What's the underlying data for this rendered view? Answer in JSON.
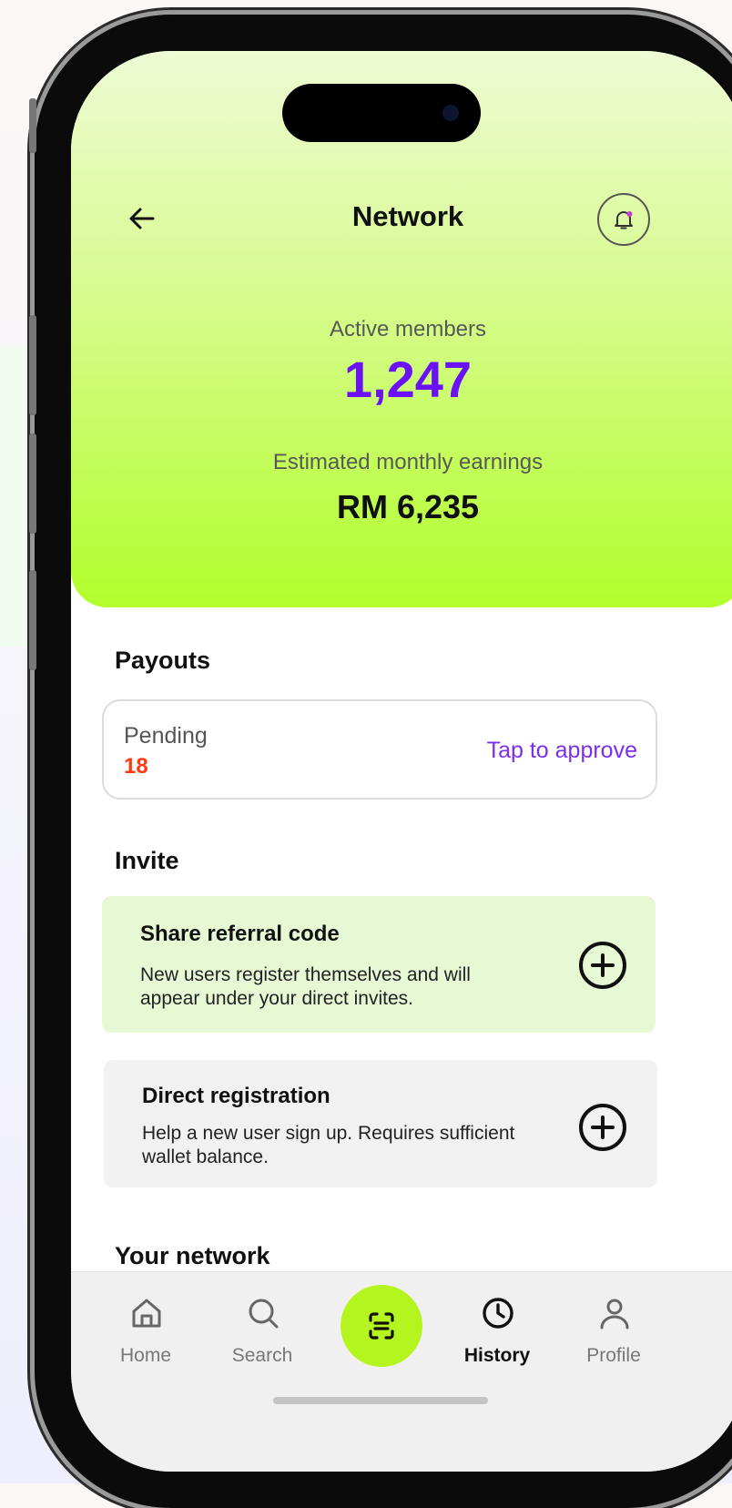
{
  "header": {
    "title": "Network",
    "back_icon": "arrow-left-icon",
    "notification_icon": "bell-icon"
  },
  "stats": {
    "members_label": "Active members",
    "members_value": "1,247",
    "earnings_label": "Estimated monthly earnings",
    "earnings_value": "RM 6,235"
  },
  "payouts": {
    "heading": "Payouts",
    "status_label": "Pending",
    "count": "18",
    "action_label": "Tap to approve"
  },
  "invite": {
    "heading": "Invite",
    "options": [
      {
        "title": "Share referral code",
        "description": "New users register themselves and will appear under your direct invites.",
        "icon": "plus-circle-icon"
      },
      {
        "title": "Direct registration",
        "description": "Help a new user sign up. Requires sufficient wallet balance.",
        "icon": "plus-circle-icon"
      }
    ]
  },
  "network_section": {
    "heading": "Your network"
  },
  "tabbar": {
    "items": [
      {
        "label": "Home",
        "icon": "home-icon"
      },
      {
        "label": "Search",
        "icon": "search-icon"
      },
      {
        "label": "",
        "icon": "scan-icon"
      },
      {
        "label": "History",
        "icon": "clock-icon"
      },
      {
        "label": "Profile",
        "icon": "user-icon"
      }
    ],
    "active": "History"
  },
  "colors": {
    "accent_green": "#b2fe2c",
    "accent_purple": "#6a11f5",
    "pending_red": "#ff3a12",
    "link_purple": "#7a2ff0",
    "referral_card_bg": "#e6f9d4",
    "registration_card_bg": "#f1f1f1"
  }
}
